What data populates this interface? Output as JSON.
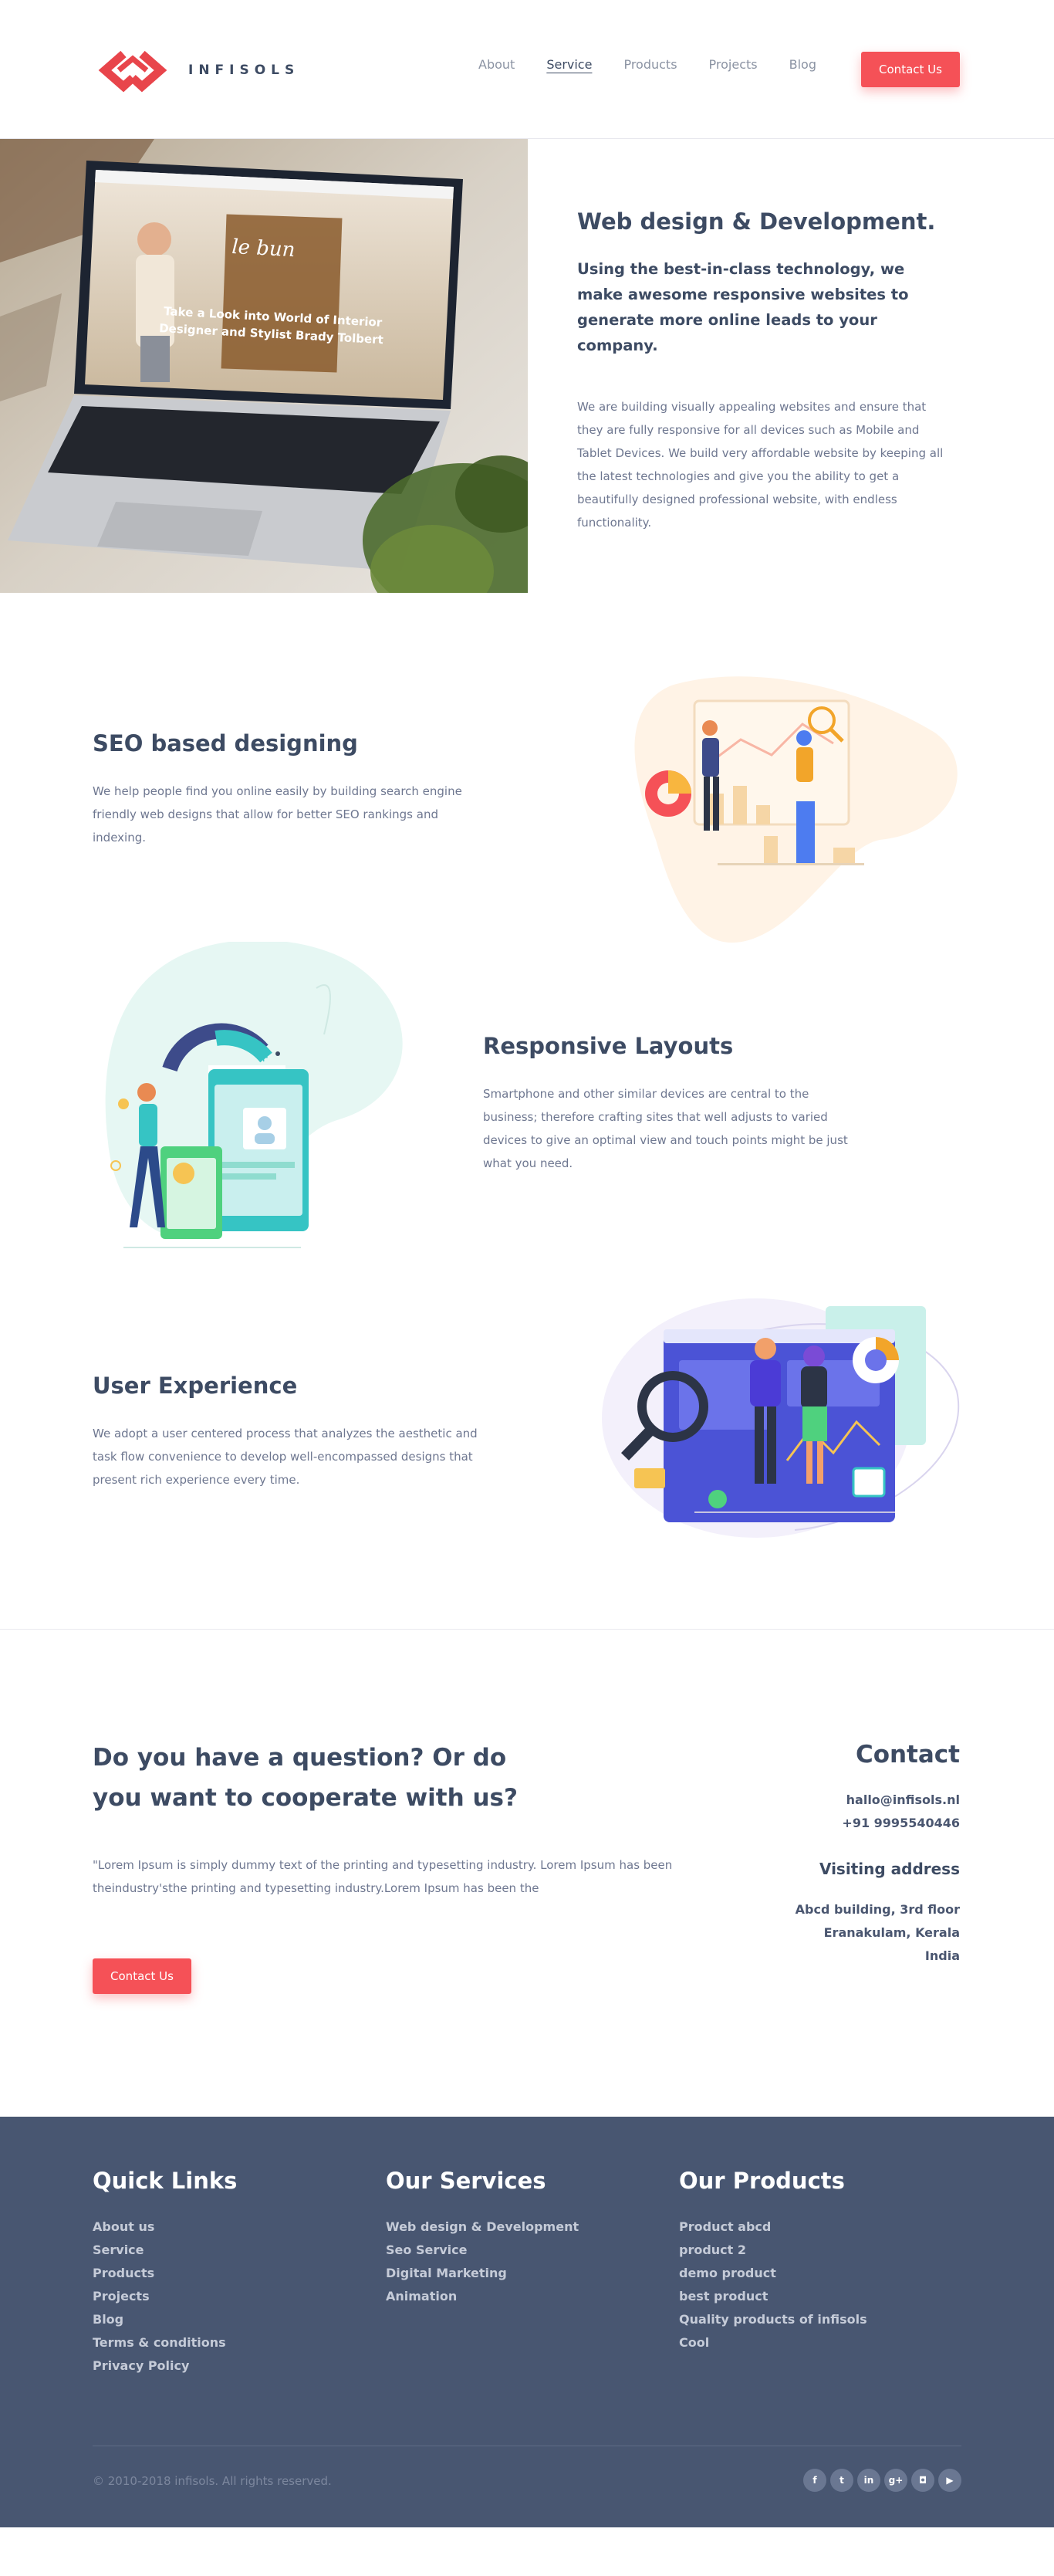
{
  "brand": {
    "name": "INFISOLS"
  },
  "colors": {
    "accent": "#f55157",
    "text": "#3d4b63",
    "muted": "#6e7790",
    "footer_bg": "#485671"
  },
  "nav": {
    "items": [
      {
        "label": "About"
      },
      {
        "label": "Service"
      },
      {
        "label": "Products"
      },
      {
        "label": "Projects"
      },
      {
        "label": "Blog"
      }
    ],
    "active": "Service",
    "cta": "Contact Us"
  },
  "hero": {
    "image": {
      "headline_line1": "Take a Look into World of Interior",
      "headline_line2": "Designer and Stylist Brady Tolbert",
      "sign": "le bun"
    },
    "title": "Web design & Development.",
    "subtitle": "Using the best-in-class technology, we make awesome responsive websites to generate more online leads to your company.",
    "paragraph": "We are building visually appealing websites and ensure that they are fully responsive for all devices such as Mobile and Tablet Devices. We build very affordable website by keeping all the latest technologies and give you the ability to get a beautifully designed professional website, with endless functionality."
  },
  "features": [
    {
      "title": "SEO based designing",
      "text": "We help people find you online easily by building search engine friendly web designs that allow for better SEO rankings and indexing.",
      "icon": "seo-illustration"
    },
    {
      "title": "Responsive Layouts",
      "text": "Smartphone and other similar devices are central to the business; therefore crafting sites that well adjusts to varied devices to give an optimal view and touch points might be just what you need.",
      "icon": "responsive-illustration"
    },
    {
      "title": "User Experience",
      "text": "We adopt a user centered process that analyzes the aesthetic and task flow convenience to develop well-encompassed designs that present rich experience every time.",
      "icon": "ux-illustration"
    }
  ],
  "contact_section": {
    "question": "Do you have a question? Or do you want to cooperate with us?",
    "text": "\"Lorem Ipsum is simply dummy text of the printing and typesetting industry. Lorem Ipsum has been theindustry'sthe printing and typesetting industry.Lorem Ipsum has been the",
    "button": "Contact Us",
    "contact_title": "Contact",
    "email": "hallo@infisols.nl",
    "phone": "+91  9995540446",
    "visiting_title": "Visiting address",
    "address": [
      "Abcd building, 3rd floor",
      "Eranakulam, Kerala",
      "India"
    ]
  },
  "footer": {
    "quick_links": {
      "title": "Quick Links",
      "items": [
        "About us",
        "Service",
        "Products",
        "Projects",
        "Blog",
        "Terms & conditions",
        "Privacy Policy"
      ]
    },
    "services": {
      "title": "Our Services",
      "items": [
        "Web design & Development",
        "Seo Service",
        "Digital Marketing",
        "Animation"
      ]
    },
    "products": {
      "title": "Our Products",
      "items": [
        "Product abcd",
        "product 2",
        "demo product",
        "best product",
        "Quality products of infisols",
        "Cool"
      ]
    },
    "copyright": "©  2010-2018 infisols. All rights reserved.",
    "socials": [
      {
        "name": "facebook-icon",
        "glyph": "f"
      },
      {
        "name": "twitter-icon",
        "glyph": "t"
      },
      {
        "name": "linkedin-icon",
        "glyph": "in"
      },
      {
        "name": "google-plus-icon",
        "glyph": "g+"
      },
      {
        "name": "instagram-icon",
        "glyph": "◘"
      },
      {
        "name": "youtube-icon",
        "glyph": "▶"
      }
    ]
  }
}
